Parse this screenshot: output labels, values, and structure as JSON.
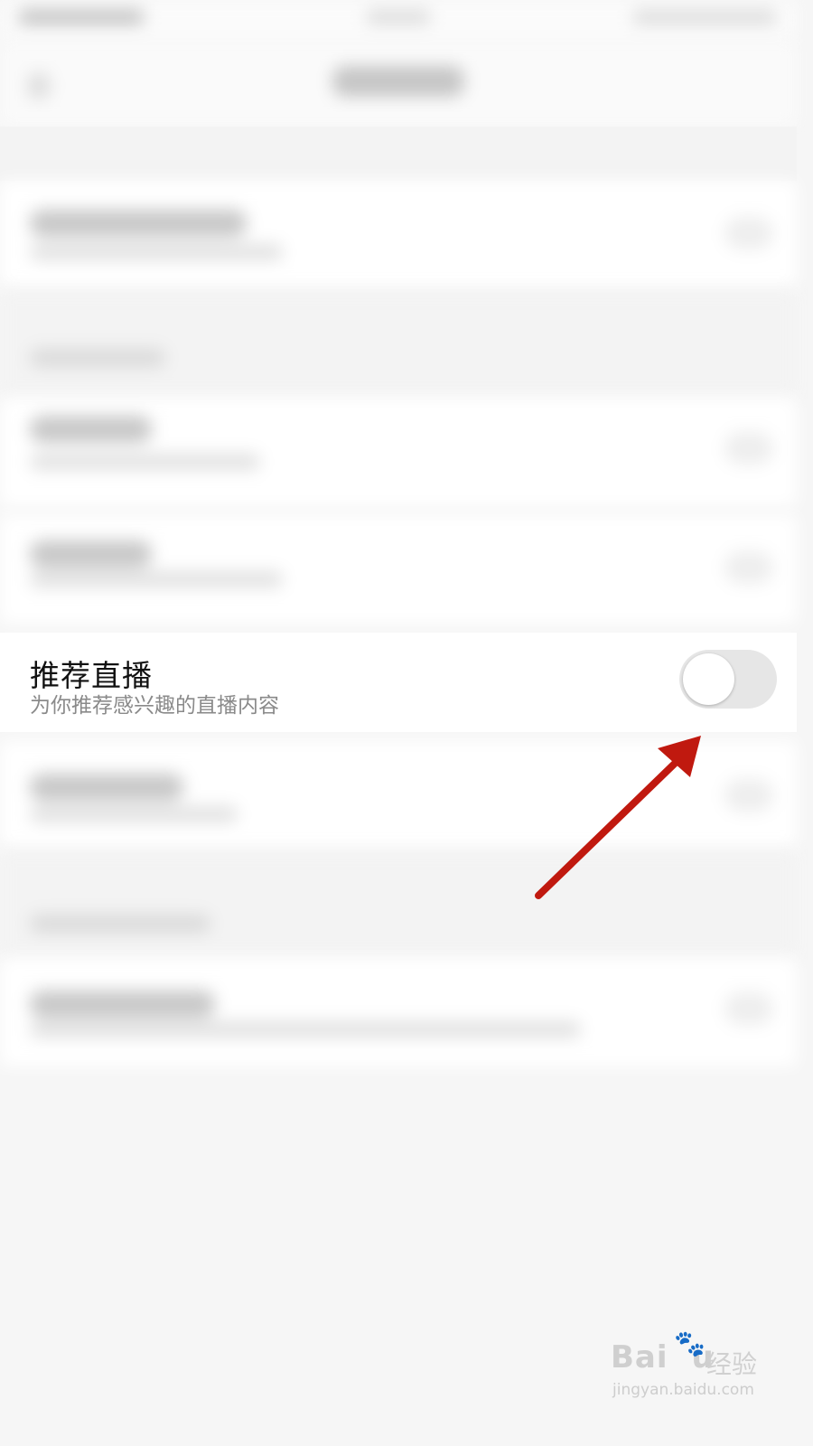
{
  "setting": {
    "title": "推荐直播",
    "subtitle": "为你推荐感兴趣的直播内容",
    "toggle_state": "off"
  },
  "colors": {
    "toggle_track_off": "#e6e6e6",
    "arrow": "#c0190f"
  },
  "watermark": {
    "brand": "Bai",
    "brand_end": "u",
    "paw_icon": "paw-icon",
    "chinese": "经验",
    "url": "jingyan.baidu.com"
  }
}
